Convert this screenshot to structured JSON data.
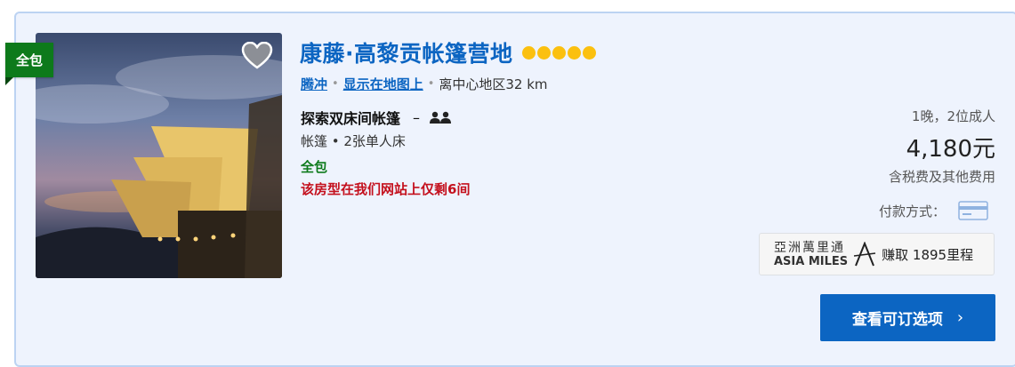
{
  "hotel": {
    "badge": "全包",
    "name": "康藤·高黎贡帐篷营地",
    "star_rating": 5,
    "heart_icon": "heart-icon",
    "location": {
      "city": "腾冲",
      "map_link": "显示在地图上",
      "distance": "离中心地区32 km"
    }
  },
  "room": {
    "name": "探索双床间帐篷",
    "dash": "–",
    "occupancy_icon": "two-guests-icon",
    "bed": "帐篷 • 2张单人床",
    "inclusive": "全包",
    "scarcity": "该房型在我们网站上仅剩6间"
  },
  "pricing": {
    "nights_guests": "1晚，2位成人",
    "price": "4,180元",
    "tax_note": "含税费及其他费用",
    "payment_label": "付款方式：",
    "payment_icon": "credit-card-icon"
  },
  "miles": {
    "logo_cn": "亞洲萬里通",
    "logo_en": "ASIA MILES",
    "earn_text": "赚取 1895里程"
  },
  "cta": {
    "label": "查看可订选项",
    "chevron": "›"
  },
  "colors": {
    "link_blue": "#0c65c2",
    "badge_green": "#0d7a1b",
    "star_gold": "#fbc00f",
    "alert_red": "#c4101d",
    "card_bg": "#eef3fd"
  }
}
